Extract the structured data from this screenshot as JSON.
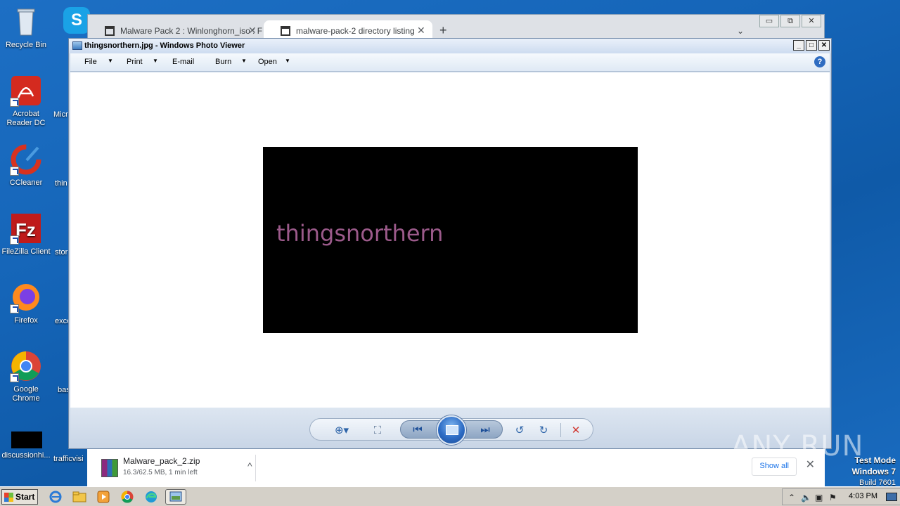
{
  "desktop": {
    "icons": [
      {
        "label": "Recycle Bin"
      },
      {
        "label": "Acrobat Reader DC"
      },
      {
        "label": "CCleaner"
      },
      {
        "label": "FileZilla Client"
      },
      {
        "label": "Firefox"
      },
      {
        "label": "Google Chrome"
      },
      {
        "label": "discussionhi..."
      }
    ],
    "partial_labels": [
      "Micr",
      "thin",
      "stor",
      "exce",
      "bas",
      "trafficvisi"
    ]
  },
  "browser": {
    "tabs": [
      {
        "label": "Malware Pack 2 : Winlonghorn_iso : F"
      },
      {
        "label": "malware-pack-2 directory listing"
      }
    ],
    "window_buttons": [
      "▭",
      "⧉",
      "✕"
    ],
    "new_tab": "+",
    "tab_dropdown": "⌄",
    "download": {
      "filename": "Malware_pack_2.zip",
      "status": "16.3/62.5 MB, 1 min left",
      "chevron": "^",
      "show_all": "Show all",
      "close": "✕"
    }
  },
  "photo_viewer": {
    "title": "thingsnorthern.jpg - Windows Photo Viewer",
    "window_buttons": [
      "_",
      "□",
      "✕"
    ],
    "menu": [
      {
        "label": "File",
        "dropdown": "▼"
      },
      {
        "label": "Print",
        "dropdown": "▼"
      },
      {
        "label": "E-mail",
        "dropdown": ""
      },
      {
        "label": "Burn",
        "dropdown": "▼"
      },
      {
        "label": "Open",
        "dropdown": "▼"
      }
    ],
    "help": "?",
    "image_text": "thingsnorthern",
    "controls": {
      "zoom": "⊕▾",
      "actual_size": "⛶",
      "previous": "⏮",
      "next": "⏭",
      "rotate_ccw": "↺",
      "rotate_cw": "↻",
      "delete": "✕"
    }
  },
  "taskbar": {
    "start_label": "Start",
    "clock": "4:03 PM",
    "tray_icons": [
      "⌃",
      "🔈",
      "▣",
      "⚑"
    ]
  },
  "watermark": "ANY RUN",
  "test_mode": {
    "line1": "Test Mode",
    "line2": "Windows 7",
    "line3": "Build 7601"
  },
  "colors": {
    "desktop": "#1565b8",
    "image_text": "#9b5a8a",
    "delete": "#d0362f"
  }
}
